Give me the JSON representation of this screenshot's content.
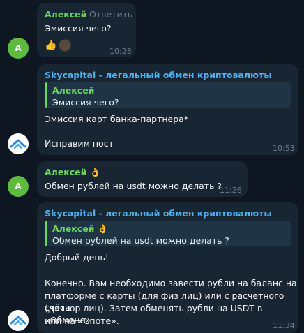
{
  "messages": [
    {
      "sender": "Алексей",
      "avatar_letter": "А",
      "reply_label": "Ответить",
      "text": "Эмиссия чего?",
      "reaction": "👍",
      "time": "10:28"
    },
    {
      "sender": "Skycapital - легальный обмен криптовалюты",
      "quote_name": "Алексей",
      "quote_text": "Эмиссия чего?",
      "line1": "Эмиссия карт банка-партнера*",
      "line2": "Исправим пост",
      "time": "10:53"
    },
    {
      "sender": "Алексей 👌",
      "avatar_letter": "А",
      "text": "Обмен рублей на usdt можно делать ?",
      "time": "11:26"
    },
    {
      "sender": "Skycapital - легальный обмен криптовалюты",
      "quote_name": "Алексей 👌",
      "quote_text": "Обмен рублей на usdt можно делать ?",
      "line1": "Добрый день!",
      "para": [
        "Конечно. Вам необходимо завести рубли на баланс на",
        "платформе с карты (для физ лиц) или с расчетного счёта",
        "(для юр лиц). Затем обменять рубли на USDT в «Обмене»",
        "или на «Споте»."
      ],
      "time": "11:34"
    }
  ],
  "colors": {
    "background": "#0e1621",
    "bubble": "#182533",
    "green_name": "#6cd65e",
    "blue_name": "#4fb0f0",
    "brand_avatar_accent": "#2f8fe0"
  }
}
